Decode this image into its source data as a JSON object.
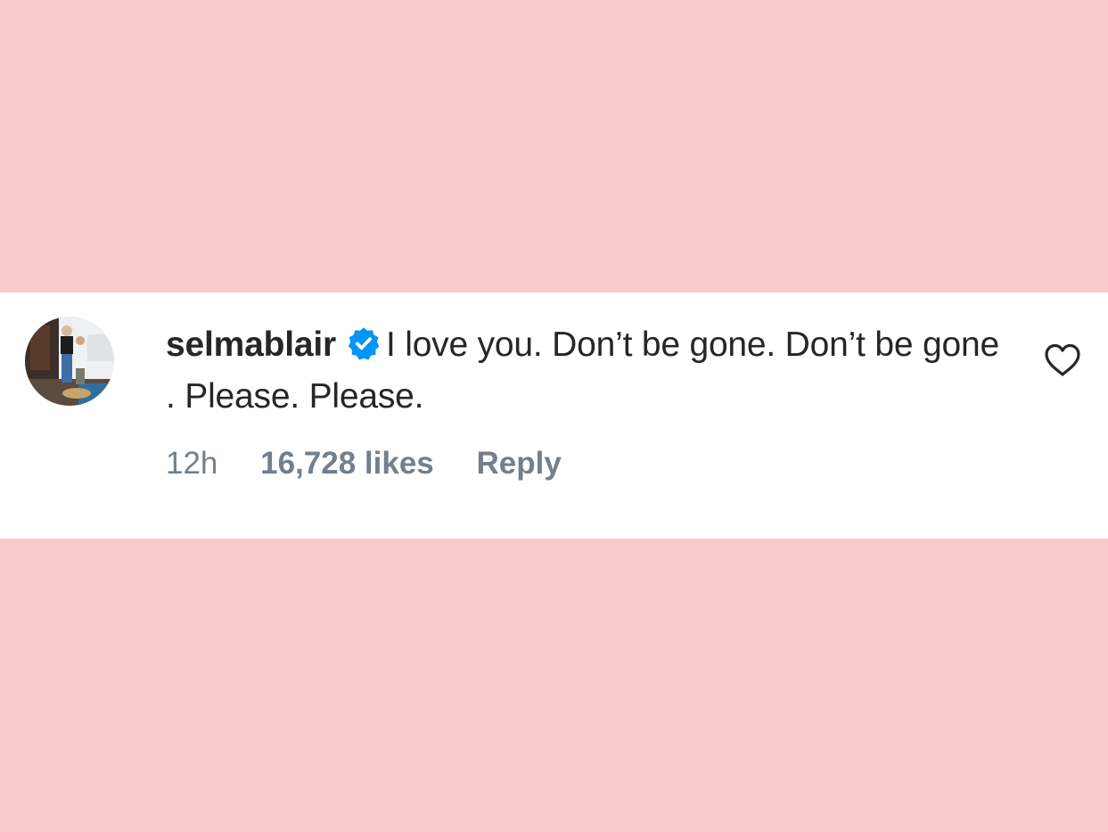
{
  "comment": {
    "username": "selmablair",
    "verified_icon": "verified-badge-icon",
    "text": "I love you. Don’t be gone. Don’t be gone . Please. Please.",
    "timestamp": "12h",
    "likes": "16,728 likes",
    "reply_label": "Reply",
    "like_icon": "heart-icon"
  },
  "colors": {
    "background": "#f9cbcd",
    "card": "#ffffff",
    "text": "#262626",
    "meta": "#737f8c",
    "verified": "#0095f6"
  }
}
